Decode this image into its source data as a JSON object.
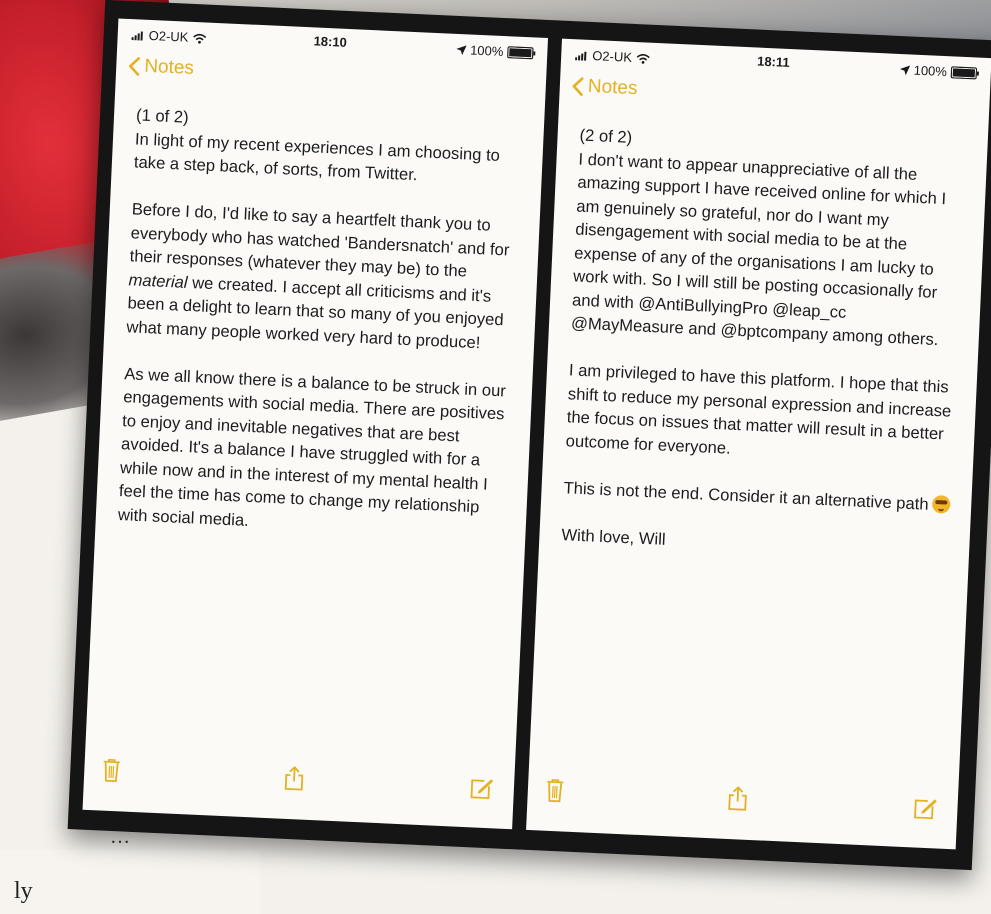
{
  "background": {
    "fragment_text": "ly",
    "fragment_dots": "…"
  },
  "screens": [
    {
      "status": {
        "carrier": "O2-UK",
        "time": "18:10",
        "battery": "100%"
      },
      "nav": {
        "back_label": "Notes"
      },
      "note": {
        "header": "(1 of 2)",
        "paragraphs": [
          "In light of my recent experiences I am choosing to take a step back, of sorts, from Twitter.",
          "Before I do, I'd like to say a heartfelt thank you to everybody who has watched 'Bandersnatch' and for their responses (whatever they may be) to the",
          "As we all know there is a balance to be struck in our engagements with social media. There are positives to enjoy and inevitable negatives that are best avoided. It's a balance I have struggled with for a while now and in the interest of my mental health I feel the time has come to change my relationship with social media."
        ],
        "para2_italic": "material",
        "para2_rest": "we created. I accept all criticisms and it's been a delight to learn that so many of you enjoyed what many people worked very hard to produce!"
      },
      "toolbar": {
        "trash": "trash-icon",
        "share": "share-icon",
        "compose": "compose-icon"
      }
    },
    {
      "status": {
        "carrier": "O2-UK",
        "time": "18:11",
        "battery": "100%"
      },
      "nav": {
        "back_label": "Notes"
      },
      "note": {
        "header": "(2 of 2)",
        "paragraphs": [
          "I don't want to appear unappreciative of all the amazing support I have received online for which I am genuinely so grateful, nor do I want my disengagement with social media to be at the expense of any of the organisations I am lucky to work with. So I will still be posting occasionally for and with @AntiBullyingPro @leap_cc @MayMeasure and @bptcompany among others.",
          "I am privileged to have this platform. I hope that this shift to reduce my personal expression and increase the focus on issues that matter will result in a better outcome for everyone.",
          "This is not the end. Consider it an alternative path",
          "With love, Will"
        ]
      },
      "toolbar": {
        "trash": "trash-icon",
        "share": "share-icon",
        "compose": "compose-icon"
      }
    }
  ],
  "colors": {
    "accent": "#e3b122",
    "frame": "#151515",
    "paper": "#fbfaf7"
  }
}
